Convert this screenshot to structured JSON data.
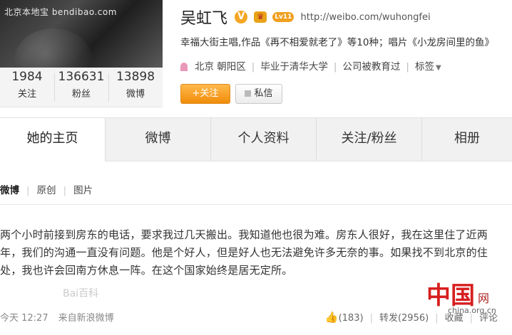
{
  "profile": {
    "avatar_watermark": "北京本地宝  bendibao.com",
    "name": "吴虹飞",
    "badge_v": "V",
    "level_badge": "Lv11",
    "url": "http://weibo.com/wuhongfei",
    "intro": "幸福大街主唱,作品《再不相爱就老了》等10种；唱片《小龙房间里的鱼》",
    "location": "北京 朝阳区",
    "school": "毕业于清华大学",
    "company": "公司被教育过",
    "tags_label": "标签",
    "stats": [
      {
        "num": "1984",
        "label": "关注"
      },
      {
        "num": "136631",
        "label": "粉丝"
      },
      {
        "num": "13898",
        "label": "微博"
      }
    ],
    "follow_label": "+关注",
    "message_label": "私信"
  },
  "tabs": [
    {
      "label": "她的主页"
    },
    {
      "label": "微博"
    },
    {
      "label": "个人资料"
    },
    {
      "label": "关注/粉丝"
    },
    {
      "label": "相册"
    }
  ],
  "filter": {
    "all": "微博",
    "original": "原创",
    "pictures": "图片"
  },
  "post": {
    "text": "两个小时前接到房东的电话，要求我过几天搬出。我知道他也很为难。房东人很好，我在这里住了近两年，我们的沟通一直没有问题。他是个好人，但是好人也无法避免许多无奈的事。如果找不到北京的住处，我也许会回南方休息一阵。在这个国家始终是居无定所。",
    "watermark": "Bai百科",
    "time": "今天 12:27",
    "source": "来自新浪微博",
    "likes": "(183)",
    "repost": "转发(2956)",
    "favorite": "收藏",
    "comment": "评论"
  },
  "corner_logo": {
    "mark": "中国",
    "net": "网",
    "domain": "china.org.cn"
  }
}
